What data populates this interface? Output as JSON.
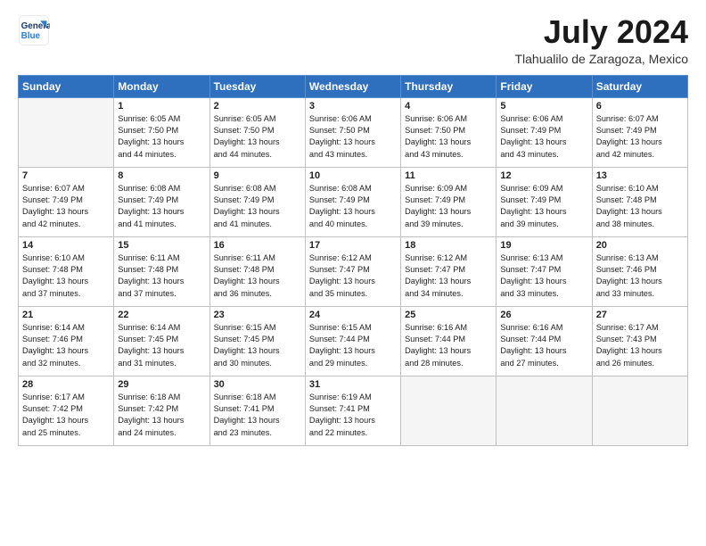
{
  "logo": {
    "line1": "General",
    "line2": "Blue"
  },
  "header": {
    "month_year": "July 2024",
    "location": "Tlahualilo de Zaragoza, Mexico"
  },
  "days_of_week": [
    "Sunday",
    "Monday",
    "Tuesday",
    "Wednesday",
    "Thursday",
    "Friday",
    "Saturday"
  ],
  "weeks": [
    [
      {
        "day": "",
        "empty": true
      },
      {
        "day": "1",
        "sunrise": "6:05 AM",
        "sunset": "7:50 PM",
        "daylight": "13 hours and 44 minutes."
      },
      {
        "day": "2",
        "sunrise": "6:05 AM",
        "sunset": "7:50 PM",
        "daylight": "13 hours and 44 minutes."
      },
      {
        "day": "3",
        "sunrise": "6:06 AM",
        "sunset": "7:50 PM",
        "daylight": "13 hours and 43 minutes."
      },
      {
        "day": "4",
        "sunrise": "6:06 AM",
        "sunset": "7:50 PM",
        "daylight": "13 hours and 43 minutes."
      },
      {
        "day": "5",
        "sunrise": "6:06 AM",
        "sunset": "7:49 PM",
        "daylight": "13 hours and 43 minutes."
      },
      {
        "day": "6",
        "sunrise": "6:07 AM",
        "sunset": "7:49 PM",
        "daylight": "13 hours and 42 minutes."
      }
    ],
    [
      {
        "day": "7",
        "sunrise": "6:07 AM",
        "sunset": "7:49 PM",
        "daylight": "13 hours and 42 minutes."
      },
      {
        "day": "8",
        "sunrise": "6:08 AM",
        "sunset": "7:49 PM",
        "daylight": "13 hours and 41 minutes."
      },
      {
        "day": "9",
        "sunrise": "6:08 AM",
        "sunset": "7:49 PM",
        "daylight": "13 hours and 41 minutes."
      },
      {
        "day": "10",
        "sunrise": "6:08 AM",
        "sunset": "7:49 PM",
        "daylight": "13 hours and 40 minutes."
      },
      {
        "day": "11",
        "sunrise": "6:09 AM",
        "sunset": "7:49 PM",
        "daylight": "13 hours and 39 minutes."
      },
      {
        "day": "12",
        "sunrise": "6:09 AM",
        "sunset": "7:49 PM",
        "daylight": "13 hours and 39 minutes."
      },
      {
        "day": "13",
        "sunrise": "6:10 AM",
        "sunset": "7:48 PM",
        "daylight": "13 hours and 38 minutes."
      }
    ],
    [
      {
        "day": "14",
        "sunrise": "6:10 AM",
        "sunset": "7:48 PM",
        "daylight": "13 hours and 37 minutes."
      },
      {
        "day": "15",
        "sunrise": "6:11 AM",
        "sunset": "7:48 PM",
        "daylight": "13 hours and 37 minutes."
      },
      {
        "day": "16",
        "sunrise": "6:11 AM",
        "sunset": "7:48 PM",
        "daylight": "13 hours and 36 minutes."
      },
      {
        "day": "17",
        "sunrise": "6:12 AM",
        "sunset": "7:47 PM",
        "daylight": "13 hours and 35 minutes."
      },
      {
        "day": "18",
        "sunrise": "6:12 AM",
        "sunset": "7:47 PM",
        "daylight": "13 hours and 34 minutes."
      },
      {
        "day": "19",
        "sunrise": "6:13 AM",
        "sunset": "7:47 PM",
        "daylight": "13 hours and 33 minutes."
      },
      {
        "day": "20",
        "sunrise": "6:13 AM",
        "sunset": "7:46 PM",
        "daylight": "13 hours and 33 minutes."
      }
    ],
    [
      {
        "day": "21",
        "sunrise": "6:14 AM",
        "sunset": "7:46 PM",
        "daylight": "13 hours and 32 minutes."
      },
      {
        "day": "22",
        "sunrise": "6:14 AM",
        "sunset": "7:45 PM",
        "daylight": "13 hours and 31 minutes."
      },
      {
        "day": "23",
        "sunrise": "6:15 AM",
        "sunset": "7:45 PM",
        "daylight": "13 hours and 30 minutes."
      },
      {
        "day": "24",
        "sunrise": "6:15 AM",
        "sunset": "7:44 PM",
        "daylight": "13 hours and 29 minutes."
      },
      {
        "day": "25",
        "sunrise": "6:16 AM",
        "sunset": "7:44 PM",
        "daylight": "13 hours and 28 minutes."
      },
      {
        "day": "26",
        "sunrise": "6:16 AM",
        "sunset": "7:44 PM",
        "daylight": "13 hours and 27 minutes."
      },
      {
        "day": "27",
        "sunrise": "6:17 AM",
        "sunset": "7:43 PM",
        "daylight": "13 hours and 26 minutes."
      }
    ],
    [
      {
        "day": "28",
        "sunrise": "6:17 AM",
        "sunset": "7:42 PM",
        "daylight": "13 hours and 25 minutes."
      },
      {
        "day": "29",
        "sunrise": "6:18 AM",
        "sunset": "7:42 PM",
        "daylight": "13 hours and 24 minutes."
      },
      {
        "day": "30",
        "sunrise": "6:18 AM",
        "sunset": "7:41 PM",
        "daylight": "13 hours and 23 minutes."
      },
      {
        "day": "31",
        "sunrise": "6:19 AM",
        "sunset": "7:41 PM",
        "daylight": "13 hours and 22 minutes."
      },
      {
        "day": "",
        "empty": true
      },
      {
        "day": "",
        "empty": true
      },
      {
        "day": "",
        "empty": true
      }
    ]
  ],
  "labels": {
    "sunrise": "Sunrise:",
    "sunset": "Sunset:",
    "daylight": "Daylight:"
  }
}
